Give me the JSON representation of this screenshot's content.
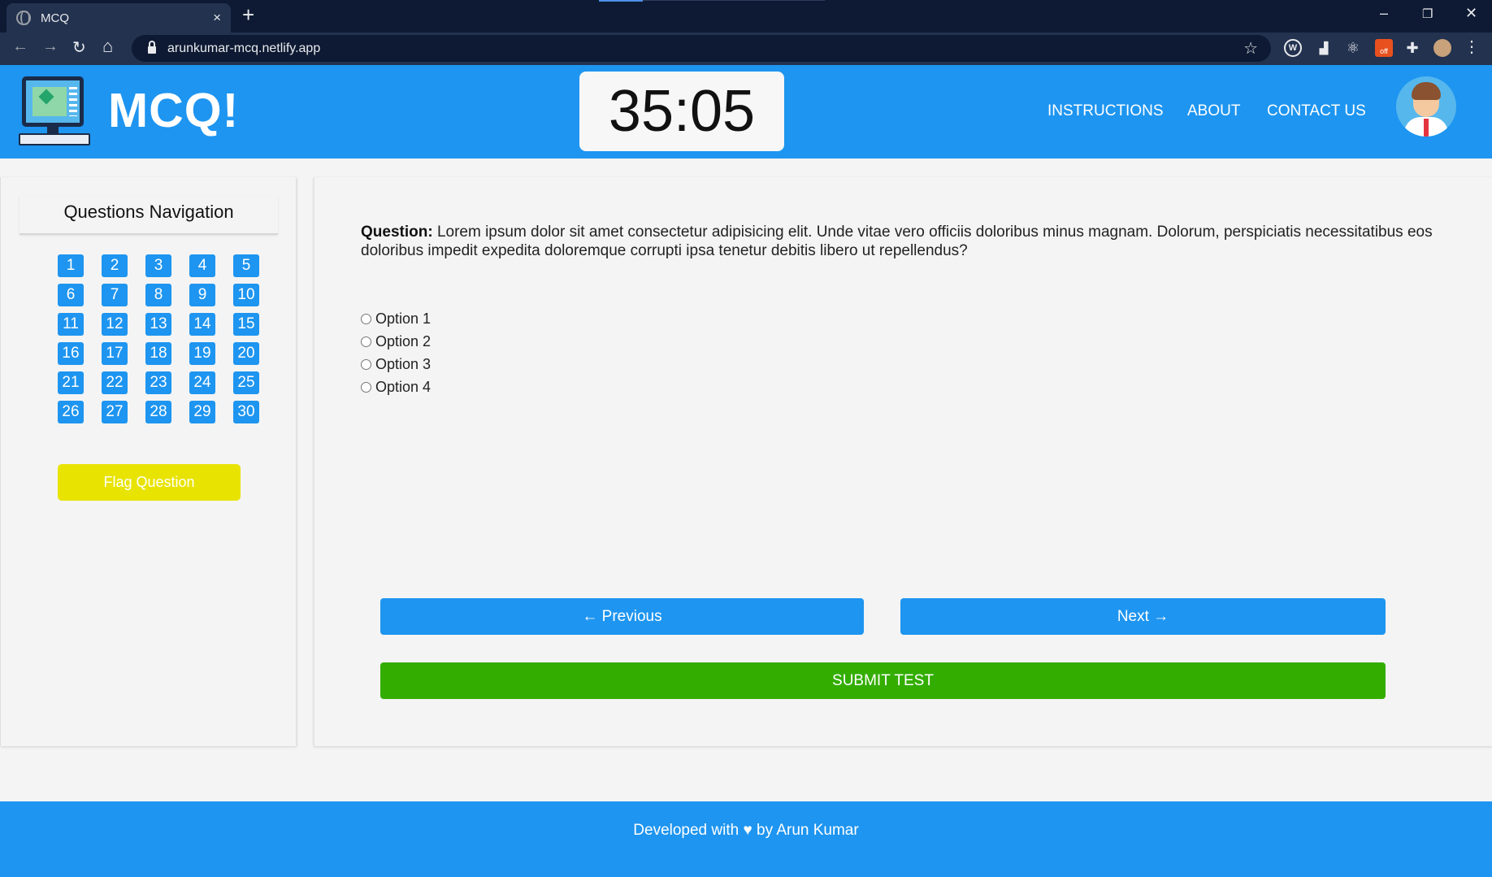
{
  "browser": {
    "tab_title": "MCQ",
    "tab_close_icon": "×",
    "new_tab_icon": "+",
    "url": "arunkumar-mcq.netlify.app",
    "back_icon": "←",
    "forward_icon": "→",
    "reload_icon": "↻",
    "home_icon": "⌂",
    "star_icon": "☆",
    "minimize_icon": "–",
    "restore_icon": "❐",
    "close_icon": "✕",
    "ext_w_label": "W",
    "ext_off_label": "off",
    "menu_icon": "⋮"
  },
  "header": {
    "brand": "MCQ!",
    "timer": "35:05",
    "nav": {
      "instructions": "INSTRUCTIONS",
      "about": "ABOUT",
      "contact": "CONTACT US"
    }
  },
  "sidebar": {
    "title": "Questions Navigation",
    "questions": [
      "1",
      "2",
      "3",
      "4",
      "5",
      "6",
      "7",
      "8",
      "9",
      "10",
      "11",
      "12",
      "13",
      "14",
      "15",
      "16",
      "17",
      "18",
      "19",
      "20",
      "21",
      "22",
      "23",
      "24",
      "25",
      "26",
      "27",
      "28",
      "29",
      "30"
    ],
    "flag_label": "Flag Question"
  },
  "main": {
    "question_prefix": "Question:",
    "question_text": " Lorem ipsum dolor sit amet consectetur adipisicing elit. Unde vitae vero officiis doloribus minus magnam. Dolorum, perspiciatis necessitatibus eos doloribus impedit expedita doloremque corrupti ipsa tenetur debitis libero ut repellendus?",
    "options": [
      "Option 1",
      "Option 2",
      "Option 3",
      "Option 4"
    ],
    "previous_label": "← Previous",
    "next_label": "Next →",
    "submit_label": "SUBMIT TEST"
  },
  "footer": {
    "text": "Developed with ♥ by Arun Kumar"
  },
  "colors": {
    "primary": "#1e95f0",
    "flag": "#e8e300",
    "submit": "#33ad00"
  }
}
